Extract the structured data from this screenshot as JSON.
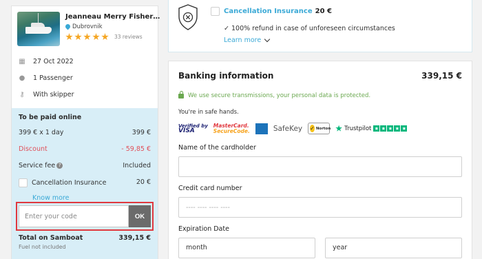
{
  "summary": {
    "boat_name": "Jeanneau Merry Fisher…",
    "location": "Dubrovnik",
    "rating": 5,
    "reviews": "33 reviews",
    "date": "27 Oct 2022",
    "passengers": "1 Passenger",
    "skipper": "With skipper"
  },
  "payment": {
    "title": "To be paid online",
    "rows": [
      {
        "label": "399 € x 1 day",
        "value": "399 €"
      },
      {
        "label": "Discount",
        "value": "- 59,85 €"
      },
      {
        "label": "Service fee",
        "value": "Included"
      },
      {
        "label": "Cancellation Insurance",
        "value": "20 €"
      }
    ],
    "know_more": "Know more",
    "code_placeholder": "Enter your code",
    "ok_label": "OK",
    "total_label": "Total on Samboat",
    "total_value": "339,15 €",
    "fuel_note": "Fuel not included"
  },
  "insurance": {
    "title": "Cancellation Insurance",
    "price": "20 €",
    "description": "✓ 100% refund in case of unforeseen circumstances",
    "learn_more": "Learn more"
  },
  "banking": {
    "title": "Banking information",
    "total": "339,15 €",
    "secure_note": "We use secure transmissions, your personal data is protected.",
    "safe_note": "You're in safe hands.",
    "logos": {
      "vbv_top": "Verified by",
      "vbv_bottom": "VISA",
      "mc_top": "MasterCard.",
      "mc_bottom": "SecureCode.",
      "amex": "AMERICAN EXPRESS",
      "safekey": "SafeKey",
      "norton": "Norton",
      "trustpilot": "Trustpilot"
    },
    "cardholder_label": "Name of the cardholder",
    "card_number_label": "Credit card number",
    "card_number_placeholder": "---- ---- ---- ----",
    "expiration_label": "Expiration Date",
    "month_placeholder": "month",
    "year_placeholder": "year"
  },
  "colors": {
    "accent": "#3aa9d6",
    "discount": "#e0505a",
    "secure": "#6aa84f",
    "summary_bg": "#d8eef7",
    "highlight_border": "#e0383e"
  }
}
